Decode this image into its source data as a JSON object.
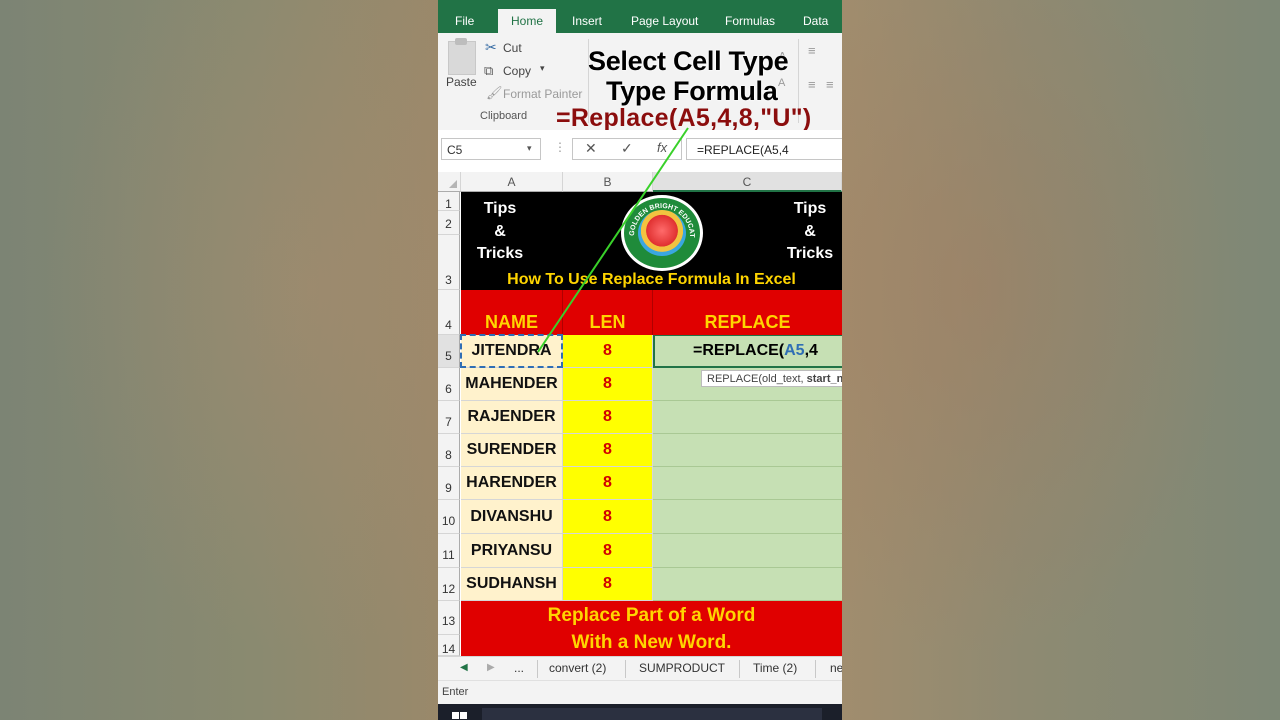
{
  "ribbon": {
    "tabs": [
      "File",
      "Home",
      "Insert",
      "Page Layout",
      "Formulas",
      "Data"
    ],
    "active_tab": "Home",
    "clipboard": {
      "paste": "Paste",
      "cut": "Cut",
      "copy": "Copy",
      "format_painter": "Format Painter",
      "group_label": "Clipboard"
    }
  },
  "overlay": {
    "line1": "Select Cell Type",
    "line2": "Type Formula",
    "formula_example": "=Replace(A5,4,8,\"U\")"
  },
  "formula_bar": {
    "name_box": "C5",
    "content": "=REPLACE(A5,4"
  },
  "columns": [
    "A",
    "B",
    "C"
  ],
  "rows": [
    "1",
    "2",
    "3",
    "4",
    "5",
    "6",
    "7",
    "8",
    "9",
    "10",
    "11",
    "12",
    "13",
    "14"
  ],
  "banner": {
    "left": [
      "Tips",
      "&",
      "Tricks"
    ],
    "right": [
      "Tips",
      "&",
      "Tricks"
    ],
    "logo_text": "GOLDEN BRIGHT EDUCATION CHANNEL",
    "headline": "How To Use  Replace  Formula In Excel"
  },
  "table": {
    "headers": [
      "NAME",
      "LEN",
      "REPLACE"
    ],
    "names": [
      "JITENDRA",
      "MAHENDER",
      "RAJENDER",
      "SURENDER",
      "HARENDER",
      "DIVANSHU",
      "PRIYANSU",
      "SUDHANSH"
    ],
    "lens": [
      "8",
      "8",
      "8",
      "8",
      "8",
      "8",
      "8",
      "8"
    ],
    "active_formula_prefix": "=REPLACE(",
    "active_formula_ref": "A5",
    "active_formula_suffix": ",4",
    "tooltip_normal": "REPLACE(old_text, ",
    "tooltip_bold": "start_n"
  },
  "footer_banner": [
    "Replace Part of a Word",
    "With a New Word."
  ],
  "sheet_tabs": [
    "...",
    "convert (2)",
    "SUMPRODUCT",
    "Time (2)",
    "ne"
  ],
  "status": "Enter",
  "colors": {
    "excel_green": "#217346",
    "header_red": "#e00000",
    "header_yellow": "#ffd500",
    "name_fill": "#fff2cc",
    "len_fill": "#ffff00",
    "replace_fill": "#c6e0b4"
  }
}
